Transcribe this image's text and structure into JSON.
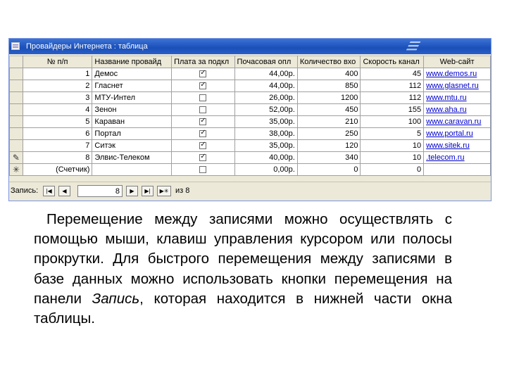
{
  "window": {
    "title": "Провайдеры Интернета : таблица"
  },
  "table": {
    "columns": [
      "№ п/п",
      "Название провайд",
      "Плата за подкл",
      "Почасовая опл",
      "Количество вхо",
      "Скорость канал",
      "Web-сайт"
    ],
    "rows": [
      {
        "num": "1",
        "name": "Демос",
        "fee": true,
        "hourly": "44,00р.",
        "count": "400",
        "speed": "45",
        "site": "www.demos.ru",
        "marker": ""
      },
      {
        "num": "2",
        "name": "Гласнет",
        "fee": true,
        "hourly": "44,00р.",
        "count": "850",
        "speed": "112",
        "site": "www.glasnet.ru",
        "marker": ""
      },
      {
        "num": "3",
        "name": "МТУ-Интел",
        "fee": false,
        "hourly": "26,00р.",
        "count": "1200",
        "speed": "112",
        "site": "www.mtu.ru",
        "marker": ""
      },
      {
        "num": "4",
        "name": "Зенон",
        "fee": false,
        "hourly": "52,00р.",
        "count": "450",
        "speed": "155",
        "site": "www.aha.ru",
        "marker": ""
      },
      {
        "num": "5",
        "name": "Караван",
        "fee": true,
        "hourly": "35,00р.",
        "count": "210",
        "speed": "100",
        "site": "www.caravan.ru",
        "marker": ""
      },
      {
        "num": "6",
        "name": "Портал",
        "fee": true,
        "hourly": "38,00р.",
        "count": "250",
        "speed": "5",
        "site": "www.portal.ru",
        "marker": ""
      },
      {
        "num": "7",
        "name": "Ситэк",
        "fee": true,
        "hourly": "35,00р.",
        "count": "120",
        "speed": "10",
        "site": "www.sitek.ru",
        "marker": ""
      },
      {
        "num": "8",
        "name": "Элвис-Телеком",
        "fee": true,
        "hourly": "40,00р.",
        "count": "340",
        "speed": "10",
        "site": ".telecom.ru",
        "marker": "✎"
      }
    ],
    "new_row": {
      "num": "(Счетчик)",
      "hourly": "0,00р.",
      "count": "0",
      "speed": "0",
      "marker": "✳"
    }
  },
  "navbar": {
    "label": "Запись:",
    "current": "8",
    "of_text": "из 8",
    "buttons": {
      "first": "|◀",
      "prev": "◀",
      "next": "▶",
      "last": "▶|",
      "new": "▶✳"
    }
  },
  "text": {
    "part1": "Перемещение между записями можно осуществлять с помощью мыши, клавиш управления курсором или полосы прокрутки. Для быстрого перемещения между записями в базе данных можно использовать кнопки перемещения на панели ",
    "italic": "Запись",
    "part2": ", которая находится в нижней части окна таблицы."
  }
}
